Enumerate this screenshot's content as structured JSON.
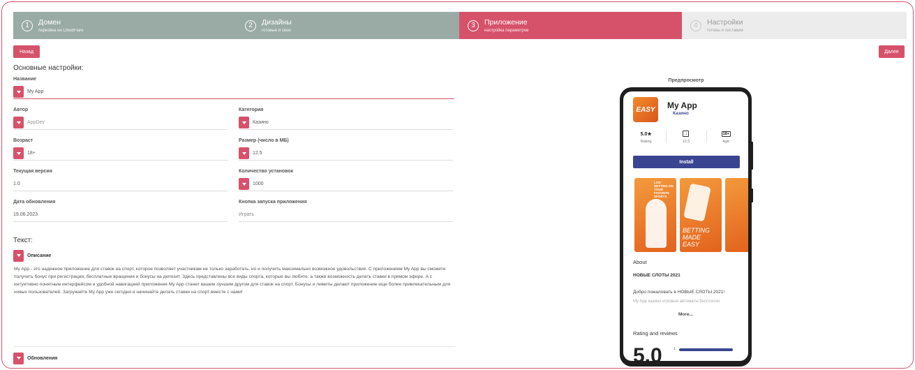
{
  "steps": [
    {
      "num": "1",
      "title": "Домен",
      "subtitle": "парковка на CloudFlare"
    },
    {
      "num": "2",
      "title": "Дизайны",
      "subtitle": "готовые и свои"
    },
    {
      "num": "3",
      "title": "Приложение",
      "subtitle": "настройка параметров"
    },
    {
      "num": "4",
      "title": "Настройки",
      "subtitle": "готовы и поставим"
    }
  ],
  "nav": {
    "back": "Назад",
    "next": "Далее"
  },
  "basic": {
    "heading": "Основные настройки:",
    "name_label": "Название",
    "name_value": "My App",
    "author_label": "Автор",
    "author_value": "AppDev",
    "category_label": "Категория",
    "category_value": "Казино",
    "age_label": "Возраст",
    "age_value": "18+",
    "size_label": "Размер (число в МБ)",
    "size_value": "12.5",
    "version_label": "Текущая версия",
    "version_value": "1.0",
    "installs_label": "Количество установок",
    "installs_value": "1000",
    "date_label": "Дата обновления",
    "date_value": "19.06.2023",
    "launch_label": "Кнопка запуска приложения",
    "launch_value": "Играть"
  },
  "text": {
    "heading": "Текст:",
    "description_label": "Описание",
    "description": "My App - это надежное приложение для ставок на спорт, которое позволяет участникам не только заработать, но и получить максимально возможное удовольствие. С приложением My App вы сможете получить бонус при регистрации, бесплатные вращения и бонусы на депозит. Здесь представлены все виды спорта, которые вы любите, а также возможность делать ставки в прямом эфире. А с интуитивно понятным интерфейсом и удобной навигацией приложение My App станет вашим лучшим другом для ставок на спорт. Бонусы и лимиты делают приложение еще более привлекательным для новых пользователей. Загружайте My App уже сегодня и начинайте делать ставки на спорт вместе с нами!",
    "updates_label": "Обновления"
  },
  "preview": {
    "label": "Предпросмотр",
    "icon_text": "EASY",
    "app_name": "My App",
    "category": "Казино",
    "rating_value": "5.0★",
    "rating_key": "Rating",
    "size_value": "12.5",
    "age_value": "18+",
    "age_key": "Age",
    "install": "Install",
    "shot1_caption": "LIVE BETTING ON YOUR FAVORITE SPORTS",
    "shot2_big": "BETTING MADE EASY",
    "about": "About",
    "p1": "НОВЫЕ СЛОТЫ 2021",
    "p2": "Добро пожаловать в НОВЫЕ СЛОТЫ 2021!",
    "p3": "My App казино игровые автоматы бесплатно",
    "more": "More...",
    "reviews": "Rating and reviews",
    "big_rating": "5.0",
    "bar_one": "1"
  },
  "colors": {
    "accent": "#d6526b",
    "done": "#9aaba5",
    "pending": "#ececec",
    "install": "#3a4591"
  }
}
